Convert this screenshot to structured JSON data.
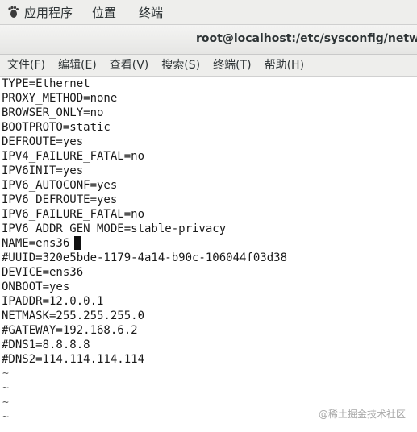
{
  "top_panel": {
    "applications_label": "应用程序",
    "places_label": "位置",
    "terminal_label": "终端"
  },
  "window": {
    "title": "root@localhost:/etc/sysconfig/network-s"
  },
  "menubar": {
    "items": [
      "文件(F)",
      "编辑(E)",
      "查看(V)",
      "搜索(S)",
      "终端(T)",
      "帮助(H)"
    ]
  },
  "terminal": {
    "lines": [
      "TYPE=Ethernet",
      "PROXY_METHOD=none",
      "BROWSER_ONLY=no",
      "BOOTPROTO=static",
      "DEFROUTE=yes",
      "IPV4_FAILURE_FATAL=no",
      "IPV6INIT=yes",
      "IPV6_AUTOCONF=yes",
      "IPV6_DEFROUTE=yes",
      "IPV6_FAILURE_FATAL=no",
      "IPV6_ADDR_GEN_MODE=stable-privacy",
      "NAME=ens36",
      "#UUID=320e5bde-1179-4a14-b90c-106044f03d38",
      "DEVICE=ens36",
      "ONBOOT=yes",
      "IPADDR=12.0.0.1",
      "NETMASK=255.255.255.0",
      "#GATEWAY=192.168.6.2",
      "#DNS1=8.8.8.8",
      "#DNS2=114.114.114.114"
    ],
    "empty_marker": "~"
  },
  "watermark": "@稀土掘金技术社区",
  "colors": {
    "panel_bg": "#eeeeec",
    "terminal_bg": "#ffffff",
    "text": "#1a1a1a"
  }
}
